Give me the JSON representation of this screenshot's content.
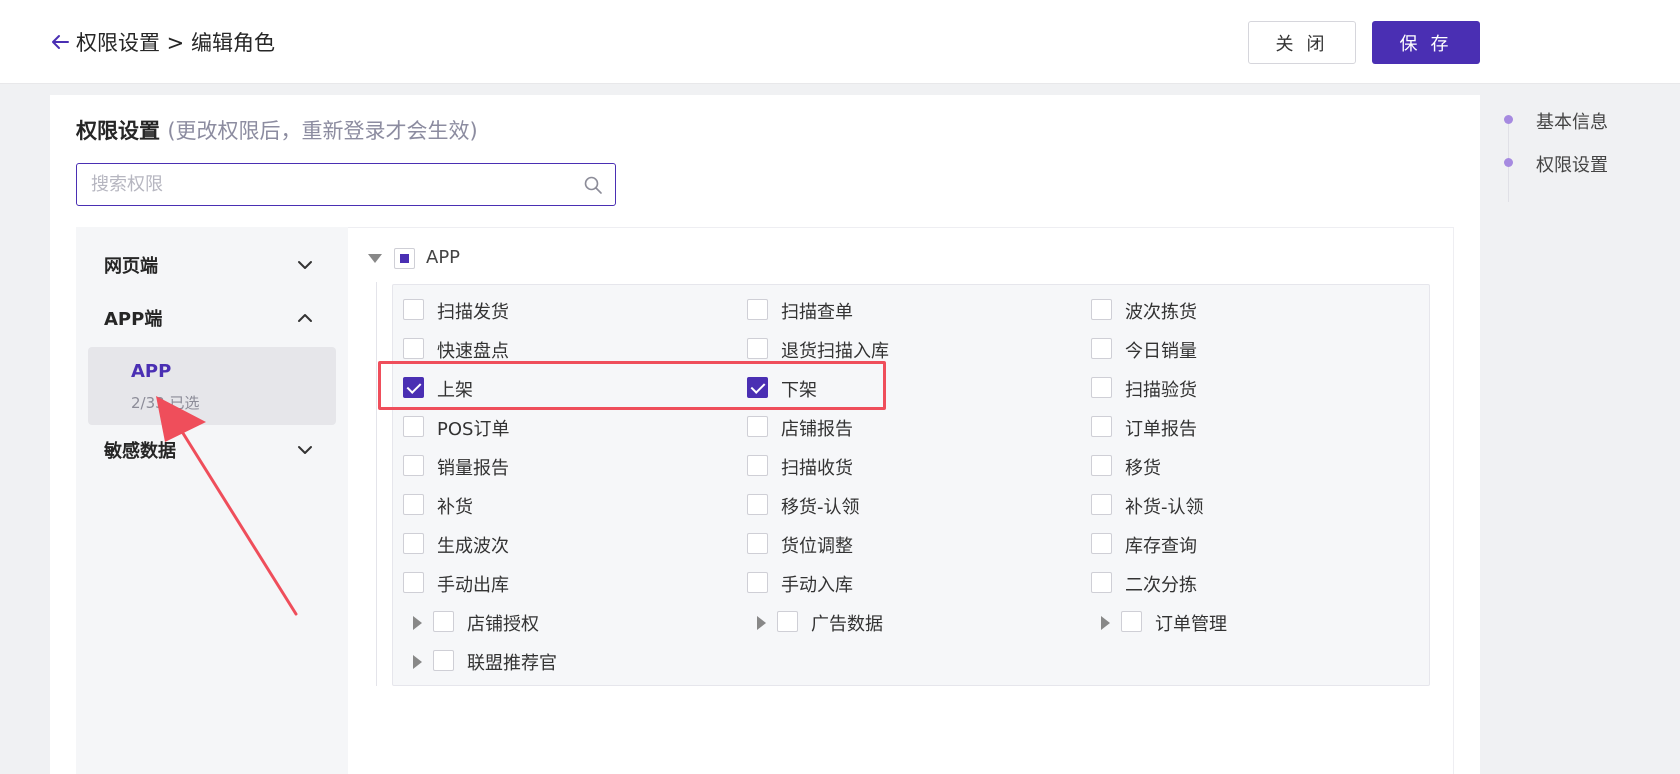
{
  "header": {
    "breadcrumb": "权限设置 > 编辑角色",
    "close_label": "关 闭",
    "save_label": "保 存"
  },
  "section": {
    "title": "权限设置",
    "note": "(更改权限后，重新登录才会生效)"
  },
  "search": {
    "placeholder": "搜索权限",
    "value": ""
  },
  "left_groups": [
    {
      "label": "网页端",
      "expanded": false
    },
    {
      "label": "APP端",
      "expanded": true
    },
    {
      "label": "敏感数据",
      "expanded": false
    }
  ],
  "selected_item": {
    "title": "APP",
    "subtitle": "2/33 已选"
  },
  "tree_root": {
    "label": "APP",
    "state": "partial"
  },
  "permissions": [
    {
      "label": "扫描发货",
      "checked": false,
      "expandable": false
    },
    {
      "label": "扫描查单",
      "checked": false,
      "expandable": false
    },
    {
      "label": "波次拣货",
      "checked": false,
      "expandable": false
    },
    {
      "label": "快速盘点",
      "checked": false,
      "expandable": false
    },
    {
      "label": "退货扫描入库",
      "checked": false,
      "expandable": false
    },
    {
      "label": "今日销量",
      "checked": false,
      "expandable": false
    },
    {
      "label": "上架",
      "checked": true,
      "expandable": false
    },
    {
      "label": "下架",
      "checked": true,
      "expandable": false
    },
    {
      "label": "扫描验货",
      "checked": false,
      "expandable": false
    },
    {
      "label": "POS订单",
      "checked": false,
      "expandable": false
    },
    {
      "label": "店铺报告",
      "checked": false,
      "expandable": false
    },
    {
      "label": "订单报告",
      "checked": false,
      "expandable": false
    },
    {
      "label": "销量报告",
      "checked": false,
      "expandable": false
    },
    {
      "label": "扫描收货",
      "checked": false,
      "expandable": false
    },
    {
      "label": "移货",
      "checked": false,
      "expandable": false
    },
    {
      "label": "补货",
      "checked": false,
      "expandable": false
    },
    {
      "label": "移货-认领",
      "checked": false,
      "expandable": false
    },
    {
      "label": "补货-认领",
      "checked": false,
      "expandable": false
    },
    {
      "label": "生成波次",
      "checked": false,
      "expandable": false
    },
    {
      "label": "货位调整",
      "checked": false,
      "expandable": false
    },
    {
      "label": "库存查询",
      "checked": false,
      "expandable": false
    },
    {
      "label": "手动出库",
      "checked": false,
      "expandable": false
    },
    {
      "label": "手动入库",
      "checked": false,
      "expandable": false
    },
    {
      "label": "二次分拣",
      "checked": false,
      "expandable": false
    },
    {
      "label": "店铺授权",
      "checked": false,
      "expandable": true
    },
    {
      "label": "广告数据",
      "checked": false,
      "expandable": true
    },
    {
      "label": "订单管理",
      "checked": false,
      "expandable": true
    },
    {
      "label": "联盟推荐官",
      "checked": false,
      "expandable": true
    }
  ],
  "anchor_nav": [
    {
      "label": "基本信息"
    },
    {
      "label": "权限设置"
    }
  ],
  "colors": {
    "accent": "#4a2fb3",
    "highlight": "#ef4e5b",
    "anchor_dot": "#a68ae0"
  },
  "icons": {
    "back": "arrow-left-icon",
    "search": "search-icon",
    "chevron_down": "chevron-down-icon",
    "chevron_up": "chevron-up-icon",
    "caret_down": "caret-down-icon",
    "caret_right": "caret-right-icon"
  }
}
